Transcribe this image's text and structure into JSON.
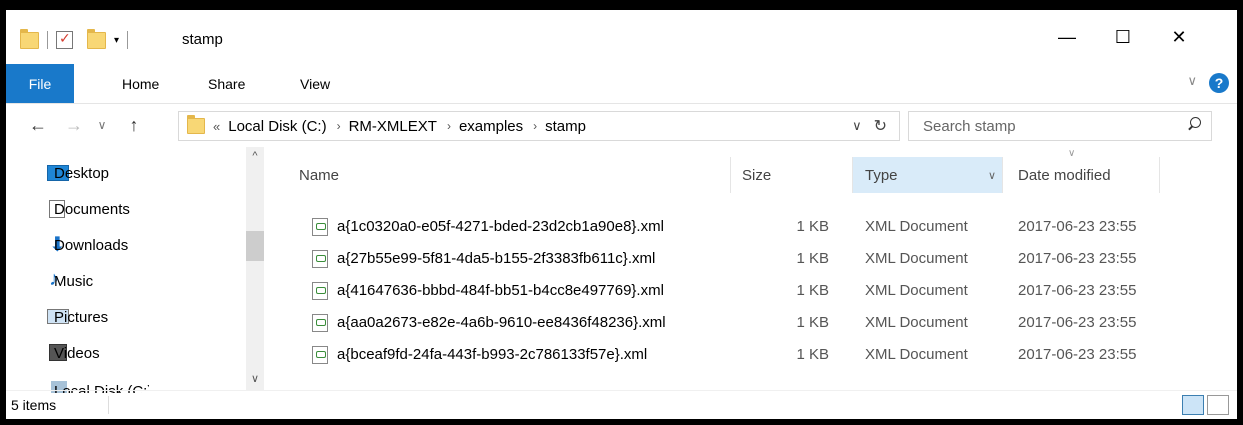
{
  "window": {
    "title": "stamp",
    "controls": {
      "minimize": "—",
      "maximize": "☐",
      "close": "✕"
    }
  },
  "ribbon": {
    "tabs": [
      "File",
      "Home",
      "Share",
      "View"
    ],
    "help": "?",
    "expand": "∨"
  },
  "nav": {
    "back": "←",
    "forward": "→",
    "recent": "∨",
    "up": "↑",
    "breadcrumbs": [
      "Local Disk (C:)",
      "RM-XMLEXT",
      "examples",
      "stamp"
    ],
    "overflow": "«",
    "crumb_sep": "›",
    "dropdown": "∨",
    "refresh": "↻",
    "search_placeholder": "Search stamp"
  },
  "sidebar": {
    "items": [
      {
        "label": "Desktop",
        "icon": "desktop-icon"
      },
      {
        "label": "Documents",
        "icon": "documents-icon"
      },
      {
        "label": "Downloads",
        "icon": "downloads-icon"
      },
      {
        "label": "Music",
        "icon": "music-icon"
      },
      {
        "label": "Pictures",
        "icon": "pictures-icon"
      },
      {
        "label": "Videos",
        "icon": "videos-icon"
      },
      {
        "label": "Local Disk (C:)",
        "icon": "drive-icon"
      }
    ],
    "scroll_up": "^",
    "scroll_down": "∨"
  },
  "columns": {
    "name": "Name",
    "size": "Size",
    "type": "Type",
    "date": "Date modified",
    "type_dropdown": "∨",
    "sort_indicator": "∨"
  },
  "files": [
    {
      "name": "a{1c0320a0-e05f-4271-bded-23d2cb1a90e8}.xml",
      "size": "1 KB",
      "type": "XML Document",
      "date": "2017-06-23 23:55"
    },
    {
      "name": "a{27b55e99-5f81-4da5-b155-2f3383fb611c}.xml",
      "size": "1 KB",
      "type": "XML Document",
      "date": "2017-06-23 23:55"
    },
    {
      "name": "a{41647636-bbbd-484f-bb51-b4cc8e497769}.xml",
      "size": "1 KB",
      "type": "XML Document",
      "date": "2017-06-23 23:55"
    },
    {
      "name": "a{aa0a2673-e82e-4a6b-9610-ee8436f48236}.xml",
      "size": "1 KB",
      "type": "XML Document",
      "date": "2017-06-23 23:55"
    },
    {
      "name": "a{bceaf9fd-24fa-443f-b993-2c786133f57e}.xml",
      "size": "1 KB",
      "type": "XML Document",
      "date": "2017-06-23 23:55"
    }
  ],
  "status": {
    "items": "5 items"
  },
  "colors": {
    "accent": "#1979ca",
    "selection": "#d9ebf9"
  }
}
